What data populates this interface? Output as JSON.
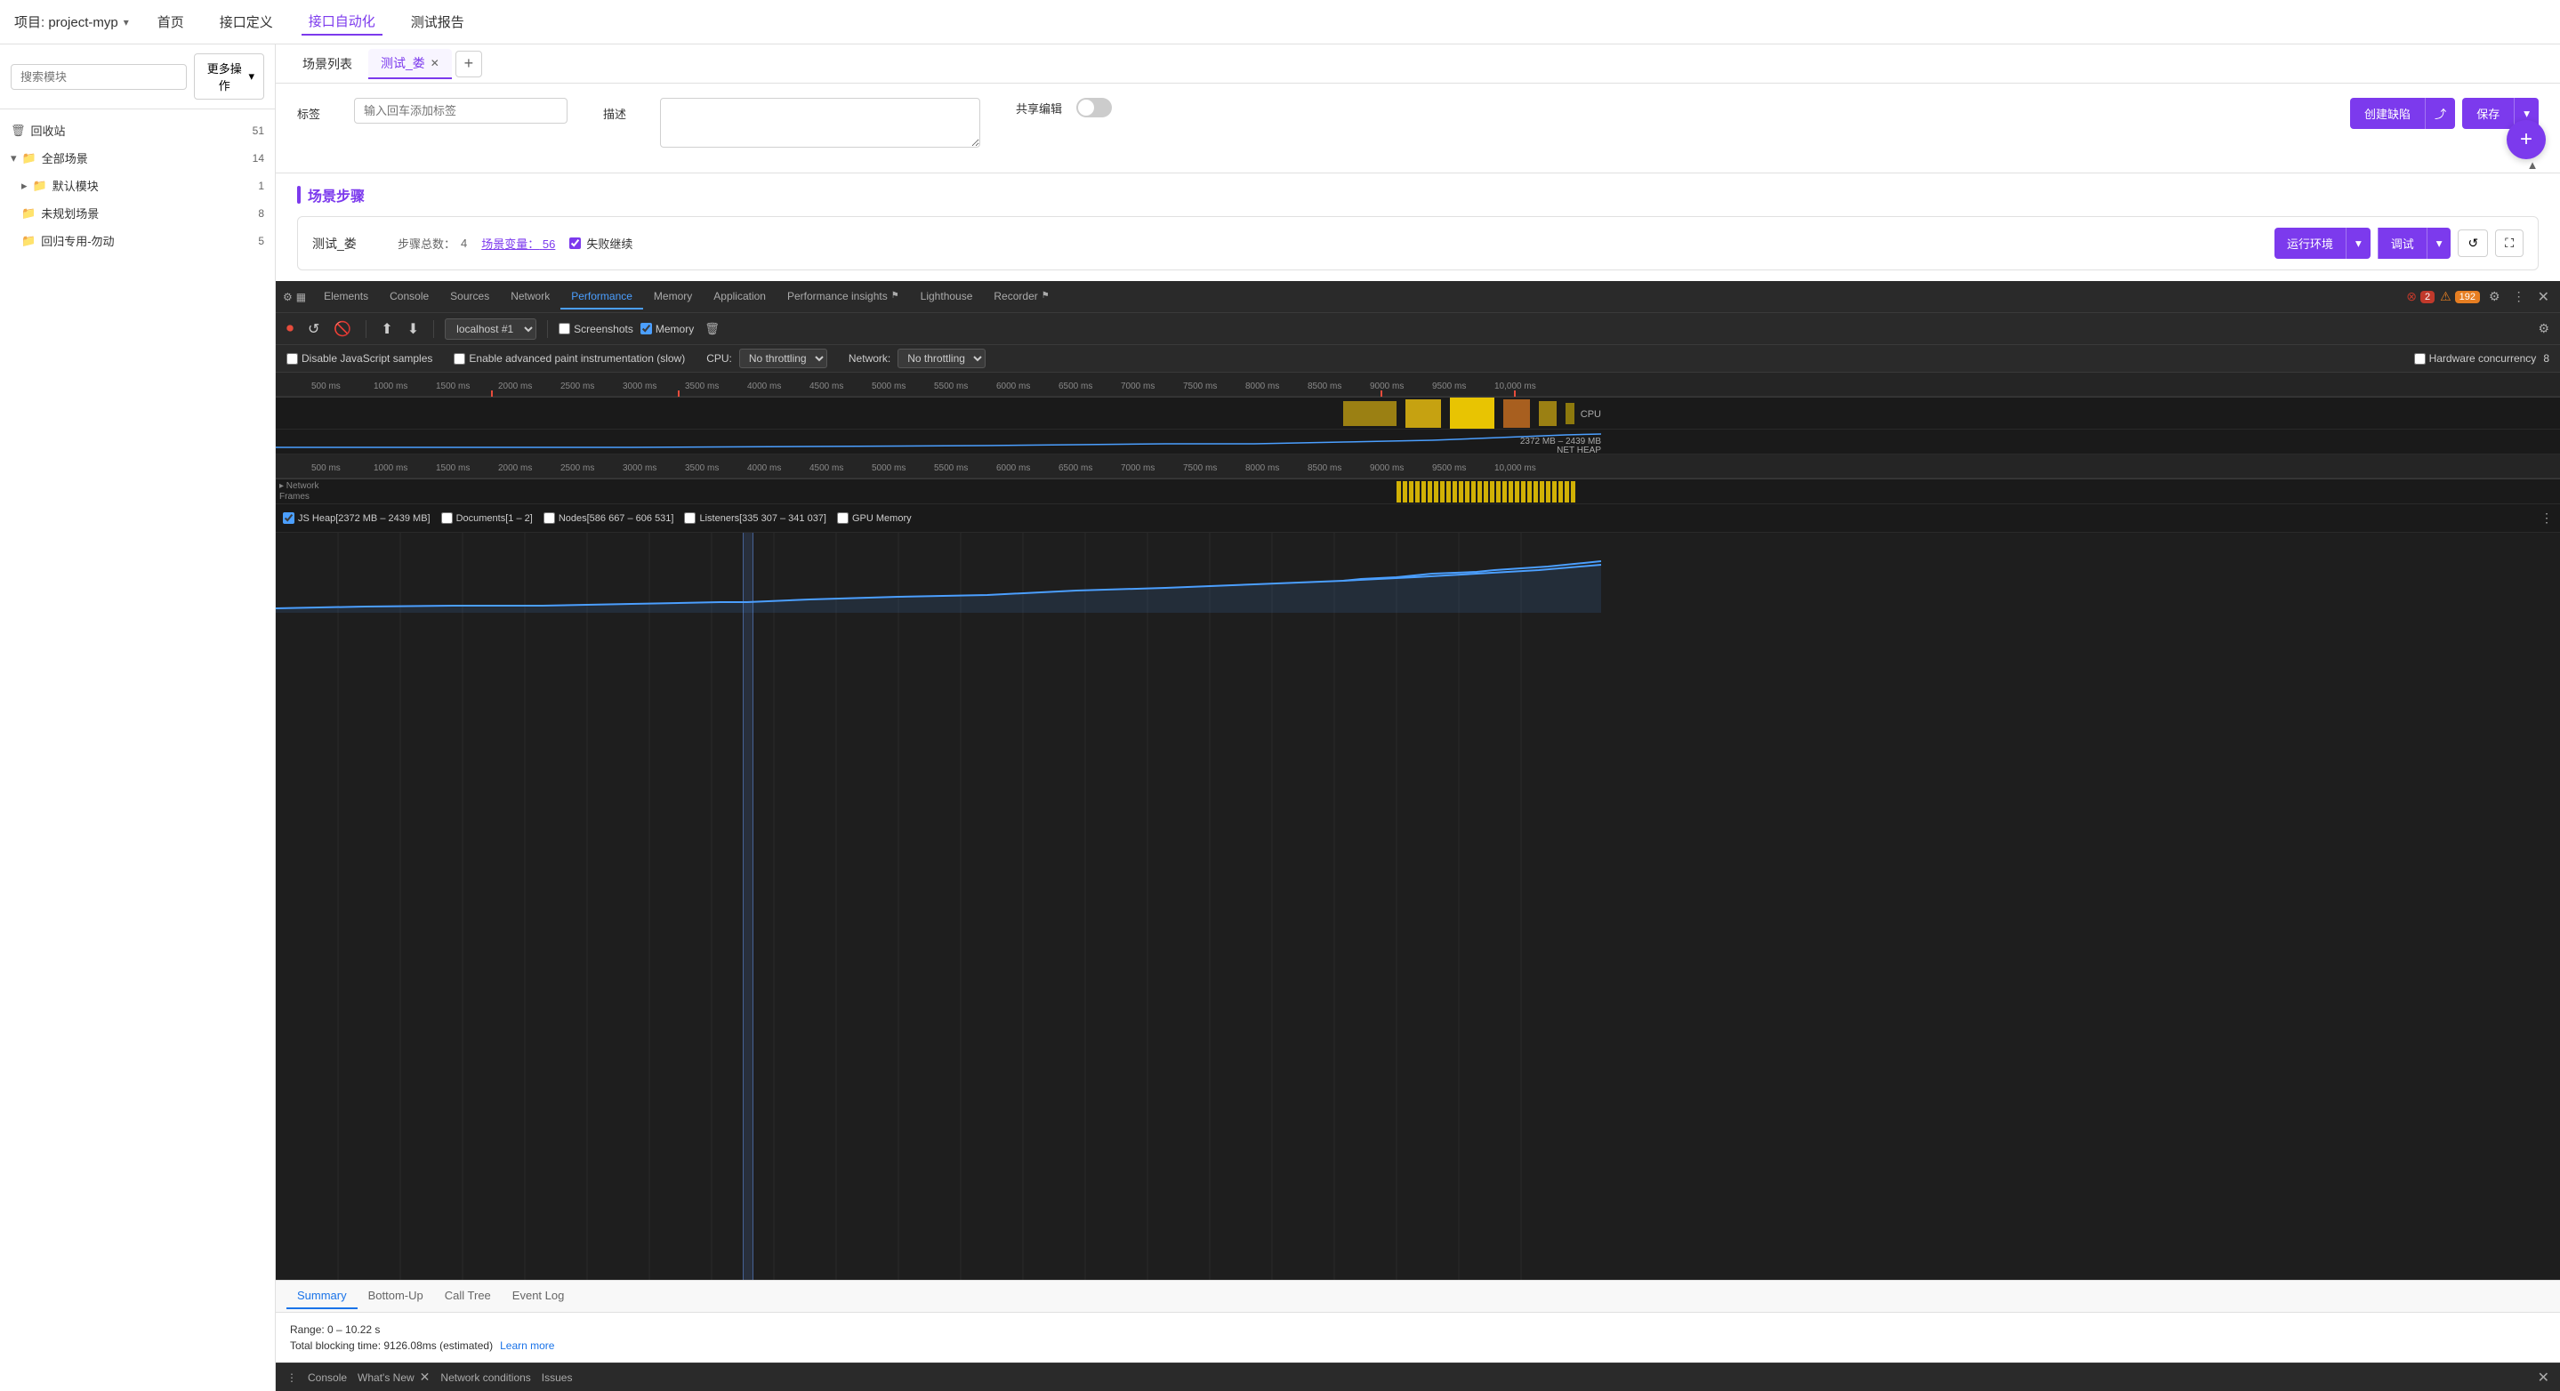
{
  "app": {
    "project_label": "项目: project-myp",
    "nav": [
      "首页",
      "接口定义",
      "接口自动化",
      "测试报告"
    ],
    "active_nav": "接口自动化"
  },
  "sidebar": {
    "search_placeholder": "搜索模块",
    "more_actions": "更多操作",
    "items": [
      {
        "icon": "🗑",
        "label": "回收站",
        "count": "51",
        "indent": 0,
        "type": "trash"
      },
      {
        "icon": "▾",
        "label": "全部场景",
        "count": "14",
        "indent": 0,
        "type": "folder",
        "expanded": true
      },
      {
        "icon": "▸",
        "label": "默认模块",
        "count": "1",
        "indent": 1,
        "type": "folder"
      },
      {
        "icon": "",
        "label": "未规划场景",
        "count": "8",
        "indent": 1,
        "type": "folder"
      },
      {
        "icon": "",
        "label": "回归专用-勿动",
        "count": "5",
        "indent": 1,
        "type": "folder"
      }
    ]
  },
  "tabs": {
    "items": [
      {
        "label": "场景列表",
        "active": false,
        "closable": false
      },
      {
        "label": "测试_娄",
        "active": true,
        "closable": true
      }
    ],
    "add_label": "+"
  },
  "form": {
    "label_field": "标签",
    "label_placeholder": "输入回车添加标签",
    "desc_field": "描述",
    "share_label": "共享编辑",
    "create_bug_label": "创建缺陷",
    "share_icon": "⤴",
    "save_label": "保存",
    "save_chevron": "▾"
  },
  "scene": {
    "title": "场景步骤",
    "name": "测试_娄",
    "steps_label": "步骤总数：",
    "steps_count": "4",
    "vars_label": "场景变量：",
    "vars_count": "56",
    "fail_continue": "失败继续",
    "run_env": "运行环境",
    "debug": "调试",
    "refresh_icon": "↺",
    "expand_icon": "⛶"
  },
  "devtools": {
    "tabs": [
      "Elements",
      "Console",
      "Sources",
      "Network",
      "Performance",
      "Memory",
      "Application",
      "Performance insights",
      "Lighthouse",
      "Recorder"
    ],
    "active_tab": "Performance",
    "error_count": "2",
    "warning_count": "192",
    "url": "localhost #1",
    "screenshots_label": "Screenshots",
    "memory_label": "Memory",
    "disable_js_label": "Disable JavaScript samples",
    "advanced_paint_label": "Enable advanced paint instrumentation (slow)",
    "cpu_label": "CPU:",
    "cpu_throttle": "No throttling",
    "network_label": "Network:",
    "network_throttle": "No throttling",
    "hw_concurrency_label": "Hardware concurrency",
    "hw_concurrency_value": "8",
    "memory_range_label": "2372 MB – 2439 MB",
    "net_heap_label": "NET HEAP"
  },
  "timeline": {
    "ticks": [
      "500 ms",
      "1000 ms",
      "1500 ms",
      "2000 ms",
      "2500 ms",
      "3000 ms",
      "3500 ms",
      "4000 ms",
      "4500 ms",
      "5000 ms",
      "5500 ms",
      "6000 ms",
      "6500 ms",
      "7000 ms",
      "7500 ms",
      "8000 ms",
      "8500 ms",
      "9000 ms",
      "9500 ms",
      "10,000 ms"
    ],
    "cpu_label": "CPU",
    "frames_label": "Frames",
    "network_label": "Network"
  },
  "legend": {
    "items": [
      {
        "label": "JS Heap[2372 MB – 2439 MB]",
        "color": "#4b9fff",
        "checked": true
      },
      {
        "label": "Documents[1 – 2]",
        "color": "#e74c3c",
        "checked": false
      },
      {
        "label": "Nodes[586 667 – 606 531]",
        "color": "#27ae60",
        "checked": false
      },
      {
        "label": "Listeners[335 307 – 341 037]",
        "color": "#f39c12",
        "checked": false
      },
      {
        "label": "GPU Memory",
        "color": "#9b59b6",
        "checked": false
      }
    ]
  },
  "bottom": {
    "tabs": [
      "Summary",
      "Bottom-Up",
      "Call Tree",
      "Event Log"
    ],
    "active_tab": "Summary",
    "range_label": "Range: 0 – 10.22 s",
    "blocking_label": "Total blocking time: 9126.08ms (estimated)",
    "learn_more": "Learn more"
  },
  "status_bar": {
    "items": [
      {
        "label": "Console",
        "active": false
      },
      {
        "label": "What's New",
        "active": false,
        "closable": true
      },
      {
        "label": "Network conditions",
        "active": false
      },
      {
        "label": "Issues",
        "active": false
      }
    ]
  }
}
